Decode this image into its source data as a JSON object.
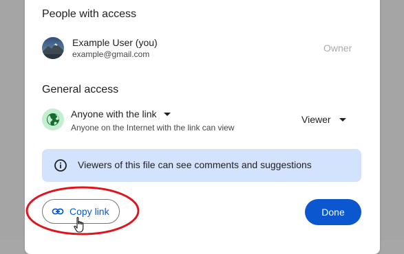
{
  "people_section": {
    "title": "People with access",
    "users": [
      {
        "name": "Example User (you)",
        "email": "example@gmail.com",
        "role": "Owner"
      }
    ]
  },
  "general_access": {
    "title": "General access",
    "link_setting": "Anyone with the link",
    "description": "Anyone on the Internet with the link can view",
    "role": "Viewer"
  },
  "info_banner": {
    "text": "Viewers of this file can see comments and suggestions"
  },
  "actions": {
    "copy_link_label": "Copy link",
    "done_label": "Done"
  },
  "icons": {
    "avatar": "avatar",
    "globe": "globe-icon",
    "info": "info-icon",
    "link": "link-icon",
    "cursor": "hand-pointer-icon"
  },
  "colors": {
    "accent": "#0b57d0",
    "banner_bg": "#d3e3fd",
    "globe_bg": "#c4eed0",
    "annotation": "#e0141c"
  }
}
